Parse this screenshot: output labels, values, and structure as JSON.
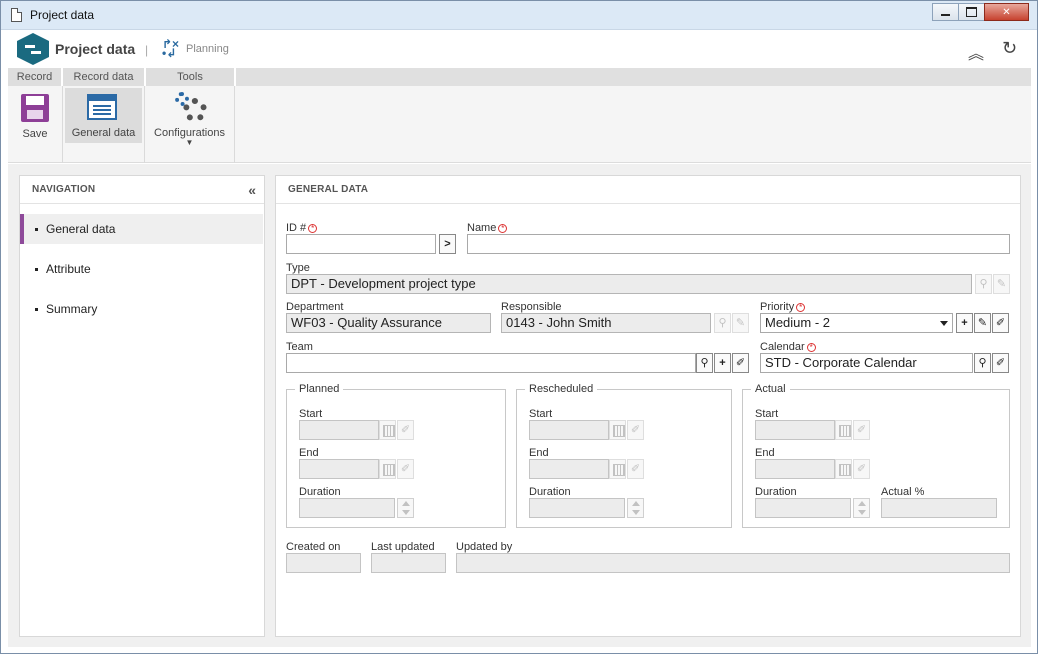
{
  "window": {
    "title": "Project data"
  },
  "header": {
    "app_title": "Project data",
    "separator": "|",
    "module": "Planning"
  },
  "ribbon": {
    "tabs": [
      "Record",
      "Record data",
      "Tools"
    ],
    "save_label": "Save",
    "general_data_label": "General data",
    "configurations_label": "Configurations"
  },
  "navigation": {
    "title": "NAVIGATION",
    "collapse_glyph": "«",
    "items": [
      {
        "label": "General data",
        "active": true
      },
      {
        "label": "Attribute",
        "active": false
      },
      {
        "label": "Summary",
        "active": false
      }
    ]
  },
  "form": {
    "title": "GENERAL DATA",
    "id_label": "ID #",
    "id_value": "",
    "name_label": "Name",
    "name_value": "",
    "type_label": "Type",
    "type_value": "DPT - Development project type",
    "department_label": "Department",
    "department_value": "WF03 - Quality Assurance",
    "responsible_label": "Responsible",
    "responsible_value": "0143 - John Smith",
    "priority_label": "Priority",
    "priority_value": "Medium - 2",
    "team_label": "Team",
    "team_value": "",
    "calendar_label": "Calendar",
    "calendar_value": "STD - Corporate Calendar",
    "planned": {
      "legend": "Planned",
      "start_label": "Start",
      "end_label": "End",
      "duration_label": "Duration"
    },
    "rescheduled": {
      "legend": "Rescheduled",
      "start_label": "Start",
      "end_label": "End",
      "duration_label": "Duration"
    },
    "actual": {
      "legend": "Actual",
      "start_label": "Start",
      "end_label": "End",
      "duration_label": "Duration",
      "percent_label": "Actual %"
    },
    "created_on_label": "Created on",
    "last_updated_label": "Last updated",
    "updated_by_label": "Updated by"
  }
}
